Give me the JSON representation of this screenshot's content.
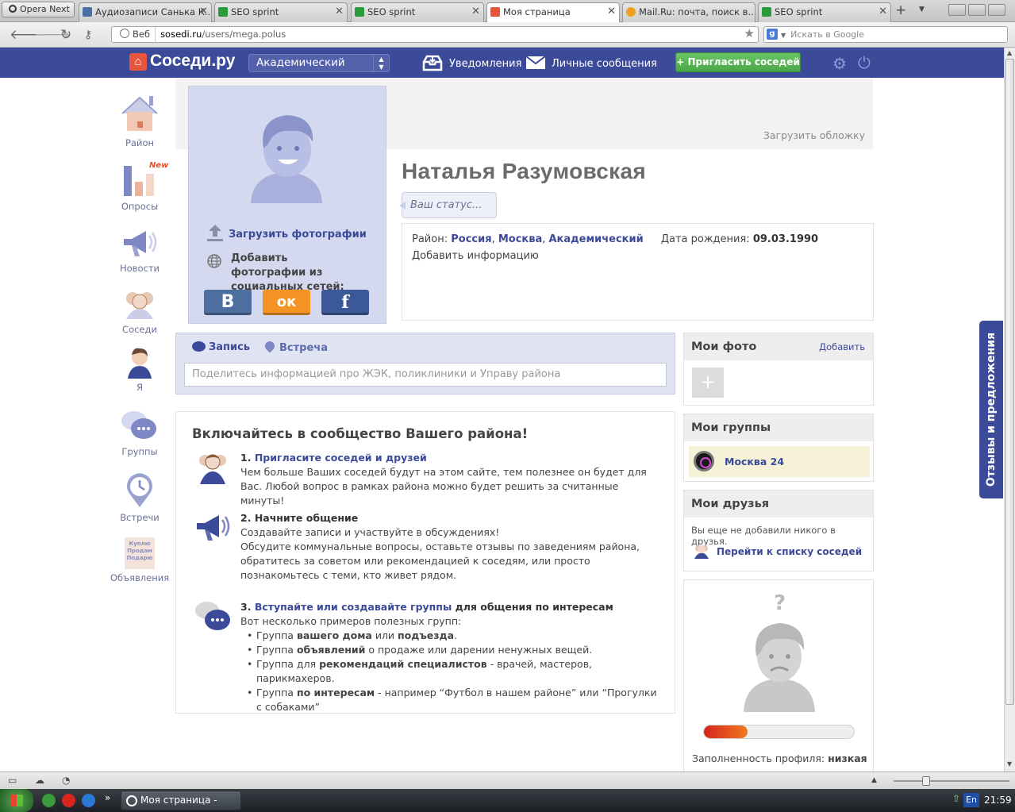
{
  "browser": {
    "opera_button": "Opera Next",
    "tabs": [
      {
        "title": "Аудиозаписи Санька К...",
        "favicon_color": "#4a6fa5"
      },
      {
        "title": "SEO sprint",
        "favicon_color": "#2a9a3a"
      },
      {
        "title": "SEO sprint",
        "favicon_color": "#2a9a3a"
      },
      {
        "title": "Моя страница",
        "favicon_color": "#e8553c"
      },
      {
        "title": "Mail.Ru: почта, поиск в...",
        "favicon_color": "#f0a020"
      },
      {
        "title": "SEO sprint",
        "favicon_color": "#2a9a3a"
      }
    ],
    "address": {
      "badge": "Веб",
      "host": "sosedi.ru",
      "path": "/users/mega.polus"
    },
    "search_placeholder": "Искать в Google"
  },
  "header": {
    "logo": "Cоседи.ру",
    "district": "Академический",
    "notifications": "Уведомления",
    "messages": "Личные сообщения",
    "invite": "+ Пригласить соседей"
  },
  "leftnav": {
    "items": [
      "Район",
      "Опросы",
      "Новости",
      "Соседи",
      "Я",
      "Группы",
      "Встречи",
      "Объявления"
    ],
    "new_badge": "New",
    "ads_icon_text": "Куплю Продам Подарю"
  },
  "profile": {
    "cover_link": "Загрузить обложку",
    "upload_photos": "Загрузить фотографии",
    "add_social": "Добавить фотографии из социальных сетей:",
    "social": [
      "В",
      "ок",
      "f"
    ],
    "name": "Наталья Разумовская",
    "status_placeholder": "Ваш статус...",
    "district_label": "Район:",
    "district_country": "Россия",
    "district_city": "Москва",
    "district_area": "Академический",
    "dob_label": "Дата рождения:",
    "dob": "09.03.1990",
    "add_info": "Добавить информацию"
  },
  "composer": {
    "tab_post": "Запись",
    "tab_meet": "Встреча",
    "placeholder": "Поделитесь информацией про ЖЭК, поликлиники и Управу района"
  },
  "welcome": {
    "title": "Включайтесь в сообщество Вашего района!",
    "step1": {
      "num": "1.",
      "title": "Пригласите соседей и друзей",
      "text": "Чем больше Ваших соседей будут на этом сайте, тем полезнее он будет для Вас. Любой вопрос в рамках района можно будет решить за считанные минуты!"
    },
    "step2": {
      "num": "2.",
      "title": "Начните общение",
      "text1": "Создавайте записи и участвуйте в обсуждениях!",
      "text2": "Обсудите коммунальные вопросы, оставьте отзывы по заведениям района, обратитесь за советом или рекомендацией к соседям, или просто познакомьтесь с теми, кто живет рядом."
    },
    "step3": {
      "num": "3.",
      "title_link": "Вступайте или создавайте группы",
      "title_rest": "для общения по интересам",
      "intro": "Вот несколько примеров полезных групп:",
      "items": [
        {
          "a": "Группа ",
          "b": "вашего дома",
          "c": " или ",
          "d": "подъезда",
          "e": "."
        },
        {
          "a": "Группа ",
          "b": "объявлений",
          "c": " о продаже или дарении ненужных вещей.",
          "d": "",
          "e": ""
        },
        {
          "a": "Группа для ",
          "b": "рекомендаций специалистов",
          "c": " - врачей, мастеров, парикмахеров.",
          "d": "",
          "e": ""
        },
        {
          "a": "Группа ",
          "b": "по интересам",
          "c": " - например “Футбол в нашем районе” или “Прогулки с собаками”",
          "d": "",
          "e": ""
        }
      ]
    }
  },
  "sidebar": {
    "photos_title": "Мои фото",
    "photos_add": "Добавить",
    "photos_plus": "+",
    "groups_title": "Мои группы",
    "group_name": "Москва 24",
    "friends_title": "Мои друзья",
    "friends_empty": "Вы еще не добавили никого в друзья.",
    "friends_link": "Перейти к списку соседей",
    "completion_question": "?",
    "completion_label": "Заполненность профиля:",
    "completion_value": "низкая",
    "completion_fraction": 0.29
  },
  "feedback": "Отзывы и предложения",
  "taskbar": {
    "task": "Моя страница - Oper...",
    "lang": "En",
    "time": "21:59"
  },
  "colors": {
    "brand": "#3b4a99",
    "invite": "#55b351",
    "accent": "#e8553c"
  }
}
